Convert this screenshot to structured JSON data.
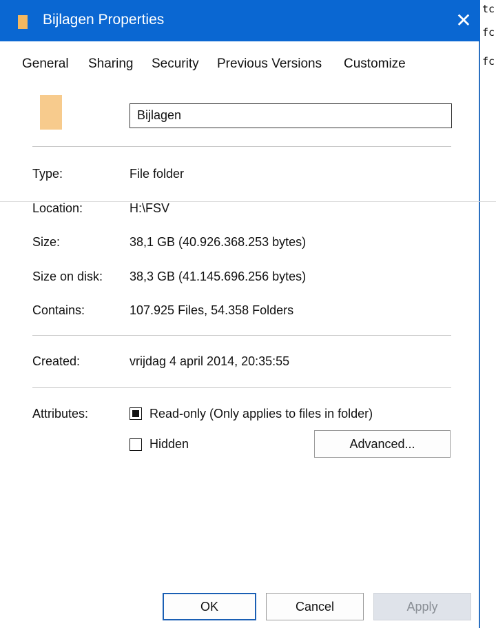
{
  "window": {
    "title": "Bijlagen Properties",
    "close_glyph": "✕",
    "colors": {
      "titlebar": "#0a67d2",
      "accent": "#1a5fb4"
    }
  },
  "background_text": [
    "tc",
    "fc",
    "fc"
  ],
  "tabs": [
    {
      "label": "General",
      "active": true
    },
    {
      "label": "Sharing"
    },
    {
      "label": "Security"
    },
    {
      "label": "Previous Versions"
    },
    {
      "label": "Customize"
    }
  ],
  "folder": {
    "icon": "folder-icon",
    "name": "Bijlagen"
  },
  "properties": {
    "type": {
      "label": "Type:",
      "value": "File folder"
    },
    "location": {
      "label": "Location:",
      "value": "H:\\FSV"
    },
    "size": {
      "label": "Size:",
      "value": "38,1 GB (40.926.368.253 bytes)"
    },
    "size_on_disk": {
      "label": "Size on disk:",
      "value": "38,3 GB (41.145.696.256 bytes)"
    },
    "contains": {
      "label": "Contains:",
      "value": "107.925 Files, 54.358 Folders"
    },
    "created": {
      "label": "Created:",
      "value": "vrijdag 4 april 2014, 20:35:55"
    }
  },
  "attributes": {
    "label": "Attributes:",
    "read_only": {
      "label": "Read-only (Only applies to files in folder)",
      "state": "indeterminate"
    },
    "hidden": {
      "label": "Hidden",
      "checked": false
    },
    "advanced_button": "Advanced..."
  },
  "buttons": {
    "ok": "OK",
    "cancel": "Cancel",
    "apply": "Apply"
  }
}
